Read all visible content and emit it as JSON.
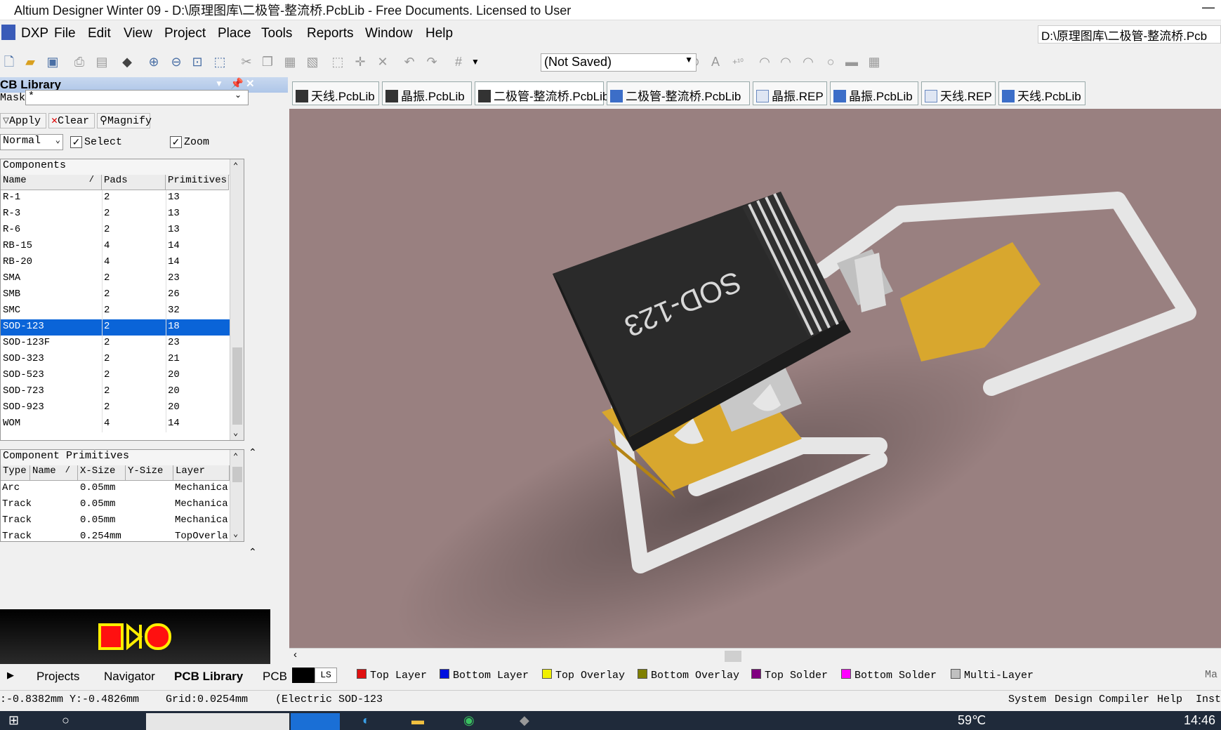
{
  "window": {
    "title": "Altium Designer Winter 09 - D:\\原理图库\\二极管-整流桥.PcbLib - Free Documents. Licensed to User",
    "minimize": "—"
  },
  "menu": [
    "DXP",
    "File",
    "Edit",
    "View",
    "Project",
    "Place",
    "Tools",
    "Reports",
    "Window",
    "Help"
  ],
  "doc_path": "D:\\原理图库\\二极管-整流桥.Pcb",
  "toolbar": {
    "not_saved": "(Not Saved)"
  },
  "panel": {
    "title": "CB Library",
    "mask_label": "Mask",
    "mask_value": "*",
    "apply": "Apply",
    "clear": "Clear",
    "magnify": "Magnify",
    "mode": "Normal",
    "select": "Select",
    "zoom": "Zoom",
    "components_title": "Components",
    "components_headers": [
      "Name",
      "Pads",
      "Primitives"
    ],
    "components": [
      {
        "name": "R-1",
        "pads": "2",
        "prims": "13"
      },
      {
        "name": "R-3",
        "pads": "2",
        "prims": "13"
      },
      {
        "name": "R-6",
        "pads": "2",
        "prims": "13"
      },
      {
        "name": "RB-15",
        "pads": "4",
        "prims": "14"
      },
      {
        "name": "RB-20",
        "pads": "4",
        "prims": "14"
      },
      {
        "name": "SMA",
        "pads": "2",
        "prims": "23"
      },
      {
        "name": "SMB",
        "pads": "2",
        "prims": "26"
      },
      {
        "name": "SMC",
        "pads": "2",
        "prims": "32"
      },
      {
        "name": "SOD-123",
        "pads": "2",
        "prims": "18",
        "selected": true
      },
      {
        "name": "SOD-123F",
        "pads": "2",
        "prims": "23"
      },
      {
        "name": "SOD-323",
        "pads": "2",
        "prims": "21"
      },
      {
        "name": "SOD-523",
        "pads": "2",
        "prims": "20"
      },
      {
        "name": "SOD-723",
        "pads": "2",
        "prims": "20"
      },
      {
        "name": "SOD-923",
        "pads": "2",
        "prims": "20"
      },
      {
        "name": "WOM",
        "pads": "4",
        "prims": "14"
      }
    ],
    "primitives_title": "Component Primitives",
    "primitives_headers": [
      "Type",
      "Name",
      "X-Size",
      "Y-Size",
      "Layer"
    ],
    "primitives": [
      {
        "type": "Arc",
        "name": "",
        "x": "0.05mm",
        "y": "",
        "layer": "Mechanica"
      },
      {
        "type": "Track",
        "name": "",
        "x": "0.05mm",
        "y": "",
        "layer": "Mechanica"
      },
      {
        "type": "Track",
        "name": "",
        "x": "0.05mm",
        "y": "",
        "layer": "Mechanica"
      },
      {
        "type": "Track",
        "name": "",
        "x": "0.254mm",
        "y": "",
        "layer": "TopOverla"
      }
    ],
    "tabs": [
      "Projects",
      "Navigator",
      "PCB Library",
      "PCB"
    ]
  },
  "doc_tabs": [
    "天线.PcbLib",
    "晶振.PcbLib",
    "二极管-整流桥.PcbLib",
    "二极管-整流桥.PcbLib",
    "晶振.REP",
    "晶振.PcbLib",
    "天线.REP",
    "天线.PcbLib"
  ],
  "component_label": "SOD-123",
  "layers": {
    "ls": "LS",
    "items": [
      {
        "name": "Top Layer",
        "color": "#e01010"
      },
      {
        "name": "Bottom Layer",
        "color": "#0010e0"
      },
      {
        "name": "Top Overlay",
        "color": "#f0f000"
      },
      {
        "name": "Bottom Overlay",
        "color": "#808000"
      },
      {
        "name": "Top Solder",
        "color": "#800080"
      },
      {
        "name": "Bottom Solder",
        "color": "#ff00ff"
      },
      {
        "name": "Multi-Layer",
        "color": "#c0c0c0"
      }
    ],
    "mask": "Ma"
  },
  "status": {
    "coords": ":-0.8382mm Y:-0.4826mm",
    "grid": "Grid:0.0254mm",
    "electric": "(Electric",
    "component": "SOD-123",
    "right": [
      "System",
      "Design Compiler",
      "Help",
      "Inst"
    ]
  },
  "taskbar": {
    "weather": "59℃",
    "time": "14:46"
  }
}
